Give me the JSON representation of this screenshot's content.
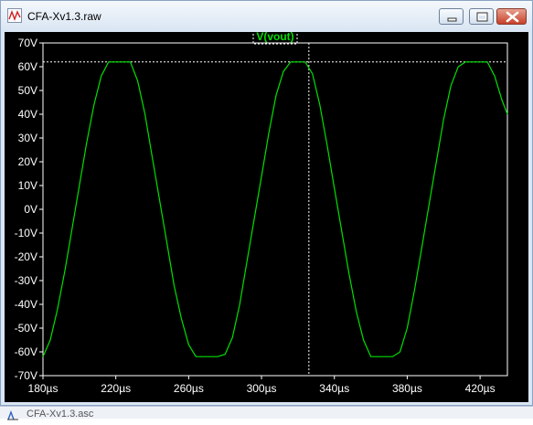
{
  "window": {
    "title": "CFA-Xv1.3.raw",
    "buttons": {
      "minimize": "minimize",
      "maximize": "maximize",
      "close": "close"
    }
  },
  "plot": {
    "trace_label": "V(vout)",
    "trace_color": "#00e000",
    "background": "#000000",
    "axis_color": "#ffffff"
  },
  "chart_data": {
    "type": "line",
    "series": [
      {
        "name": "V(vout)",
        "color": "#00e000",
        "points": [
          [
            180,
            -62
          ],
          [
            184,
            -55
          ],
          [
            188,
            -42
          ],
          [
            192,
            -26
          ],
          [
            196,
            -8
          ],
          [
            200,
            10
          ],
          [
            204,
            28
          ],
          [
            208,
            44
          ],
          [
            212,
            56
          ],
          [
            216,
            62
          ],
          [
            220,
            62
          ],
          [
            224,
            62
          ],
          [
            228,
            62
          ],
          [
            232,
            54
          ],
          [
            236,
            40
          ],
          [
            240,
            22
          ],
          [
            244,
            4
          ],
          [
            248,
            -14
          ],
          [
            252,
            -32
          ],
          [
            256,
            -46
          ],
          [
            260,
            -57
          ],
          [
            264,
            -62
          ],
          [
            268,
            -62
          ],
          [
            272,
            -62
          ],
          [
            276,
            -62
          ],
          [
            280,
            -61
          ],
          [
            284,
            -54
          ],
          [
            288,
            -40
          ],
          [
            292,
            -22
          ],
          [
            296,
            -4
          ],
          [
            300,
            14
          ],
          [
            304,
            32
          ],
          [
            308,
            48
          ],
          [
            312,
            58
          ],
          [
            316,
            62
          ],
          [
            320,
            62
          ],
          [
            324,
            62
          ],
          [
            328,
            57
          ],
          [
            332,
            44
          ],
          [
            336,
            27
          ],
          [
            340,
            9
          ],
          [
            344,
            -9
          ],
          [
            348,
            -27
          ],
          [
            352,
            -43
          ],
          [
            356,
            -55
          ],
          [
            360,
            -62
          ],
          [
            364,
            -62
          ],
          [
            368,
            -62
          ],
          [
            372,
            -62
          ],
          [
            376,
            -60
          ],
          [
            380,
            -50
          ],
          [
            384,
            -34
          ],
          [
            388,
            -16
          ],
          [
            392,
            2
          ],
          [
            396,
            20
          ],
          [
            400,
            38
          ],
          [
            404,
            52
          ],
          [
            408,
            60
          ],
          [
            412,
            62
          ],
          [
            416,
            62
          ],
          [
            420,
            62
          ],
          [
            424,
            62
          ],
          [
            428,
            56
          ],
          [
            432,
            46
          ],
          [
            435,
            40
          ]
        ]
      }
    ],
    "x_ticks": [
      "180µs",
      "220µs",
      "260µs",
      "300µs",
      "340µs",
      "380µs",
      "420µs"
    ],
    "x_tick_values": [
      180,
      220,
      260,
      300,
      340,
      380,
      420
    ],
    "y_ticks": [
      "70V",
      "60V",
      "50V",
      "40V",
      "30V",
      "20V",
      "10V",
      "0V",
      "-10V",
      "-20V",
      "-30V",
      "-40V",
      "-50V",
      "-60V",
      "-70V"
    ],
    "y_tick_values": [
      70,
      60,
      50,
      40,
      30,
      20,
      10,
      0,
      -10,
      -20,
      -30,
      -40,
      -50,
      -60,
      -70
    ],
    "xlim": [
      180,
      435
    ],
    "ylim": [
      -70,
      70
    ],
    "cursor": {
      "x": 326,
      "y": 62
    },
    "grid": false,
    "legend": "top-center"
  },
  "bottom": {
    "tab_text": "CFA-Xv1.3.asc"
  }
}
